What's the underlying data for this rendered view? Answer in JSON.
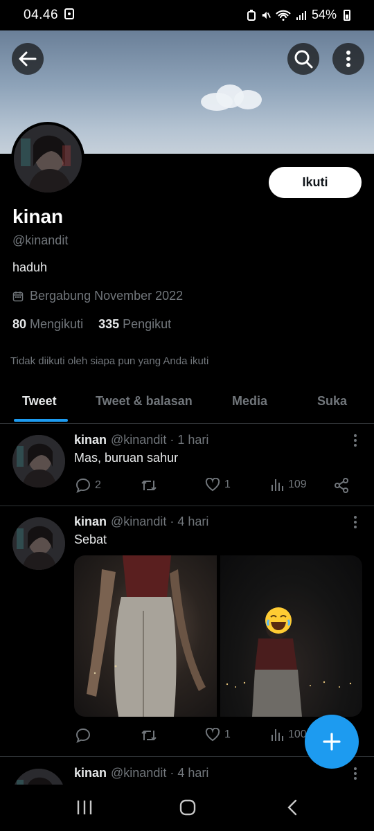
{
  "status_bar": {
    "time": "04.46",
    "battery": "54%"
  },
  "profile": {
    "name": "kinan",
    "handle": "@kinandit",
    "bio": "haduh",
    "joined": "Bergabung November 2022",
    "following_count": "80",
    "following_label": "Mengikuti",
    "followers_count": "335",
    "followers_label": "Pengikut",
    "follow_button": "Ikuti",
    "not_followed_note": "Tidak diikuti oleh siapa pun yang Anda ikuti"
  },
  "tabs": [
    {
      "label": "Tweet",
      "active": true
    },
    {
      "label": "Tweet & balasan",
      "active": false
    },
    {
      "label": "Media",
      "active": false
    },
    {
      "label": "Suka",
      "active": false
    }
  ],
  "tweets": [
    {
      "name": "kinan",
      "handle": "@kinandit",
      "time": "· 1 hari",
      "text": "Mas, buruan sahur",
      "replies": "2",
      "retweets": "",
      "likes": "1",
      "views": "109"
    },
    {
      "name": "kinan",
      "handle": "@kinandit",
      "time": "· 4 hari",
      "text": "Sebat",
      "replies": "",
      "retweets": "",
      "likes": "1",
      "views": "100"
    },
    {
      "name": "kinan",
      "handle": "@kinandit",
      "time": "· 4 hari"
    }
  ],
  "fab": {
    "icon": "plus-icon"
  },
  "colors": {
    "accent": "#1d9bf0",
    "background": "#000000",
    "muted": "#71767b"
  }
}
